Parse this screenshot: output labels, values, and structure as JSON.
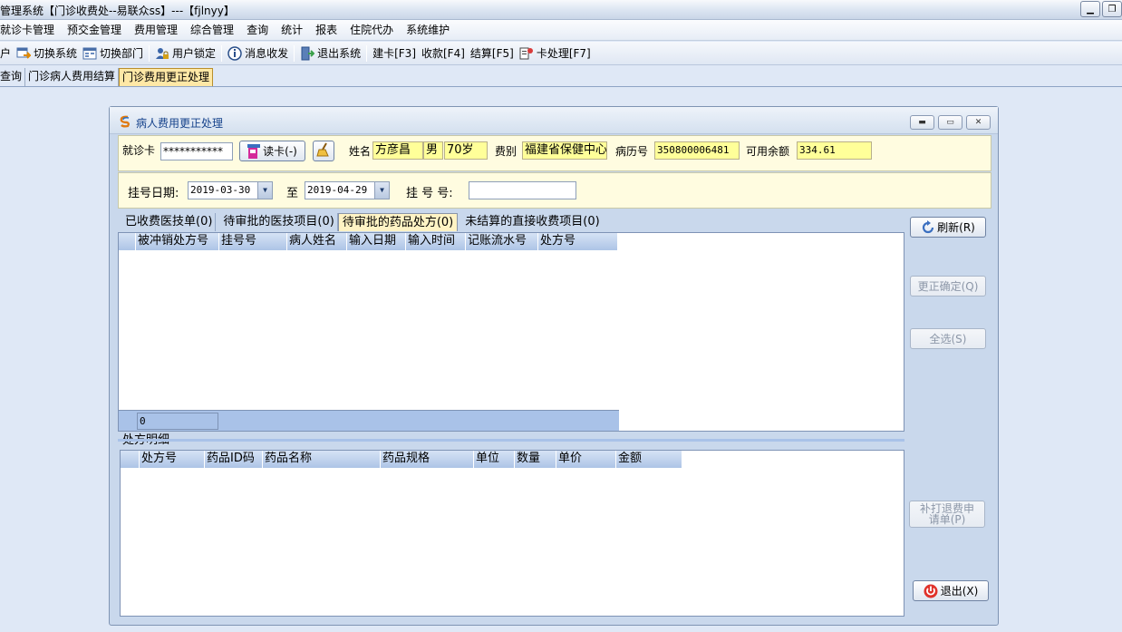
{
  "window": {
    "title": "管理系统【门诊收费处--易联众ss】---【fjlnyy】"
  },
  "menu": [
    "就诊卡管理",
    "预交金管理",
    "费用管理",
    "综合管理",
    "查询",
    "统计",
    "报表",
    "住院代办",
    "系统维护"
  ],
  "toolbar": {
    "first_label": "户",
    "items": [
      "切换系统",
      "切换部门",
      "用户锁定",
      "消息收发",
      "退出系统"
    ],
    "shortcuts": [
      "建卡[F3]",
      "收款[F4]",
      "结算[F5]",
      "卡处理[F7]"
    ]
  },
  "doc_tabs": [
    "查询",
    "门诊病人费用结算",
    "门诊费用更正处理"
  ],
  "dialog": {
    "title": "病人费用更正处理",
    "card_label": "就诊卡",
    "card_value": "***********",
    "read_card_button": "读卡(-)",
    "name_label": "姓名",
    "name_value": "方彦昌",
    "gender_value": "男",
    "age_value": "70岁",
    "fee_type_label": "费别",
    "fee_type_value": "福建省保健中心",
    "record_no_label": "病历号",
    "record_no_value": "350800006481",
    "balance_label": "可用余额",
    "balance_value": "334.61",
    "reg_date_label": "挂号日期:",
    "date_from": "2019-03-30",
    "to_label": "至",
    "date_to": "2019-04-29",
    "reg_no_label": "挂 号 号:",
    "reg_no_value": "",
    "tabs": [
      "已收费医技单(0)",
      "待审批的医技项目(0)",
      "待审批的药品处方(0)",
      "未结算的直接收费项目(0)"
    ],
    "active_tab": 2,
    "top_grid": {
      "columns": [
        "被冲销处方号",
        "挂号号",
        "病人姓名",
        "输入日期",
        "输入时间",
        "记账流水号",
        "处方号"
      ],
      "footer_count": "0"
    },
    "detail_label": "处方明细",
    "detail_grid": {
      "columns": [
        "处方号",
        "药品ID码",
        "药品名称",
        "药品规格",
        "单位",
        "数量",
        "单价",
        "金额"
      ]
    },
    "buttons": {
      "refresh": "刷新(R)",
      "confirm": "更正确定(Q)",
      "select_all": "全选(S)",
      "reprint": "补打退费申请单(P)",
      "exit": "退出(X)"
    }
  }
}
